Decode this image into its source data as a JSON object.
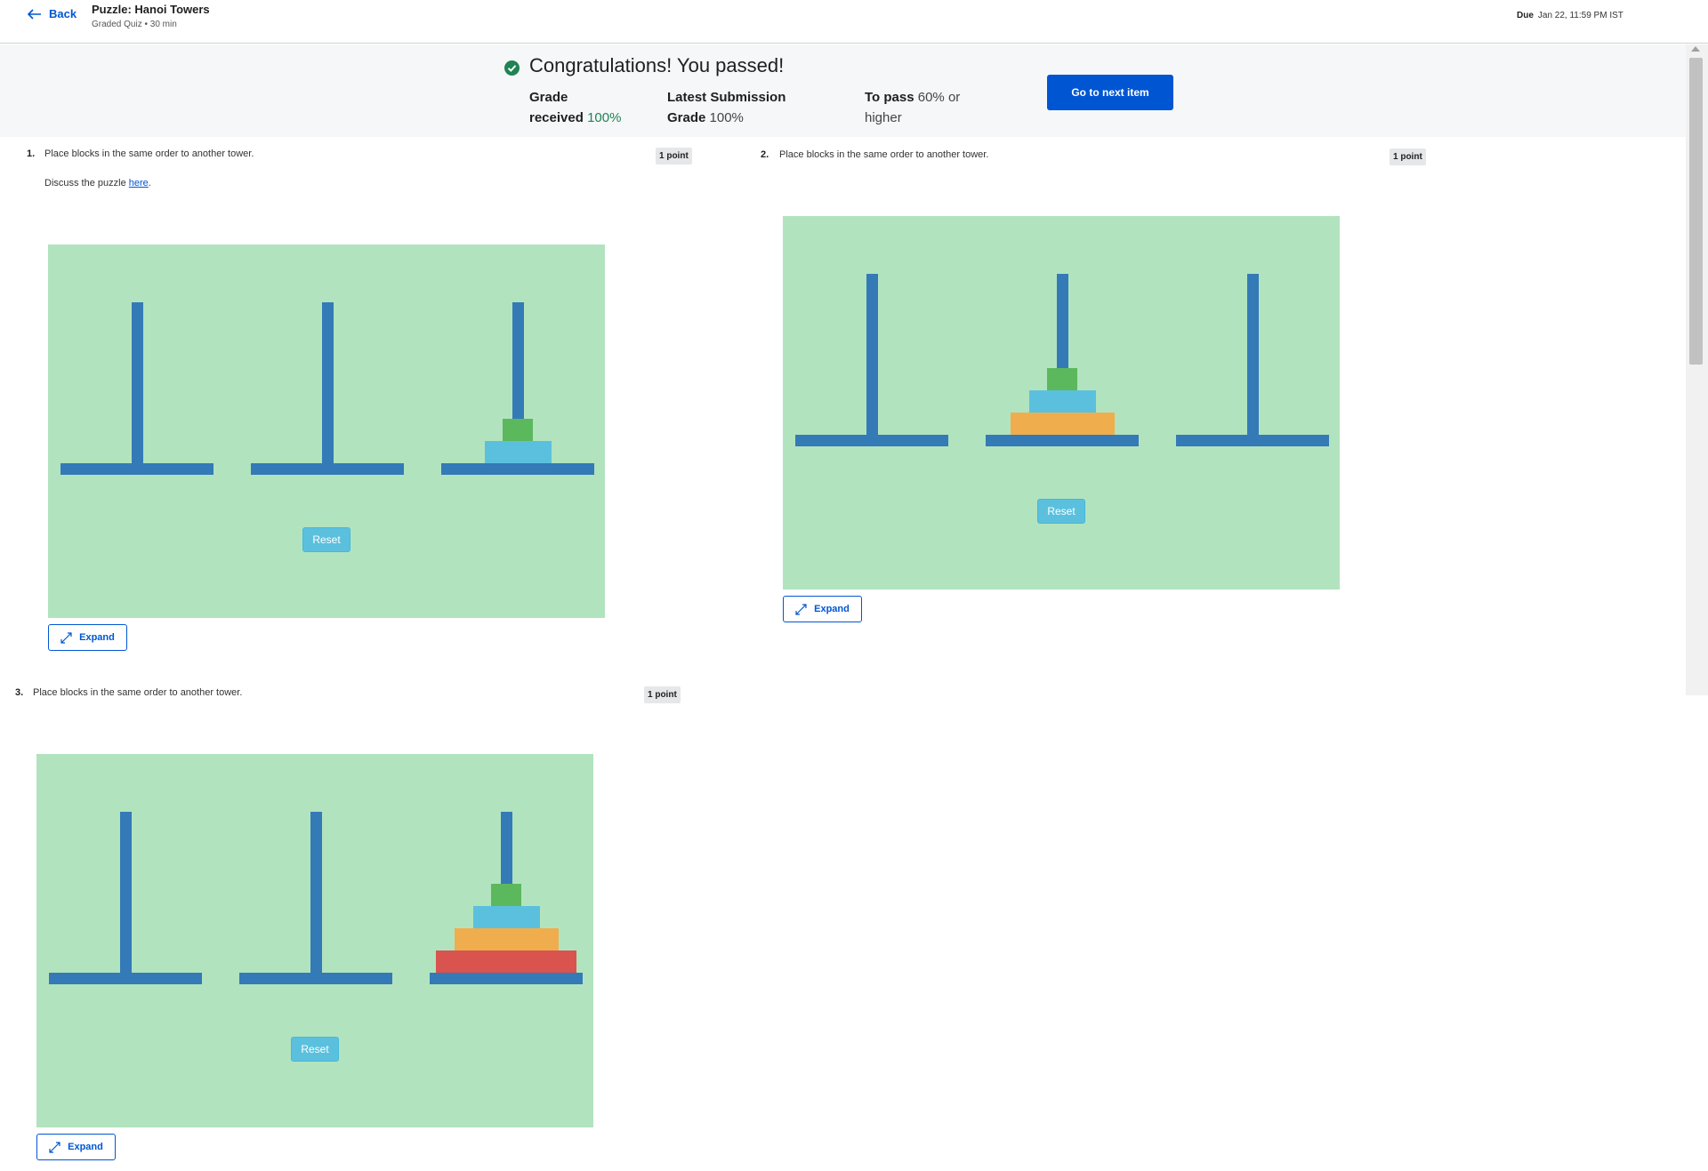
{
  "header": {
    "back_label": "Back",
    "title": "Puzzle: Hanoi Towers",
    "subtitle": "Graded Quiz • 30 min",
    "due_label": "Due",
    "due_value": "Jan 22, 11:59 PM IST"
  },
  "banner": {
    "title": "Congratulations! You passed!",
    "grade_label_1": "Grade",
    "grade_label_2": "received",
    "grade_value": "100%",
    "latest_label_1": "Latest Submission",
    "latest_label_2": "Grade",
    "latest_value": "100%",
    "pass_label": "To pass",
    "pass_value_1": "60% or",
    "pass_value_2": "higher",
    "next_button": "Go to next item",
    "accent_color": "#0056d2",
    "success_color": "#1f8354"
  },
  "questions": [
    {
      "number": "1.",
      "text": "Place blocks in the same order to another tower.",
      "points": "1 point",
      "discuss_prefix": "Discuss the puzzle ",
      "discuss_link": "here",
      "discuss_suffix": ".",
      "reset_label": "Reset",
      "expand_label": "Expand",
      "towers": [
        [],
        [],
        [
          "light-blue",
          "green"
        ]
      ]
    },
    {
      "number": "2.",
      "text": "Place blocks in the same order to another tower.",
      "points": "1 point",
      "reset_label": "Reset",
      "expand_label": "Expand",
      "towers": [
        [],
        [
          "orange",
          "light-blue",
          "green"
        ],
        []
      ]
    },
    {
      "number": "3.",
      "text": "Place blocks in the same order to another tower.",
      "points": "1 point",
      "reset_label": "Reset",
      "expand_label": "Expand",
      "towers": [
        [],
        [],
        [
          "red",
          "orange",
          "light-blue",
          "green"
        ]
      ]
    }
  ],
  "colors": {
    "board": "#b2e3bf",
    "peg": "#337ab7",
    "green": "#5cb85c",
    "light-blue": "#5bc0de",
    "orange": "#f0ad4e",
    "red": "#d9534f"
  },
  "icons": {
    "back": "arrow-left-icon",
    "check": "check-circle-icon",
    "expand": "expand-arrows-icon"
  }
}
